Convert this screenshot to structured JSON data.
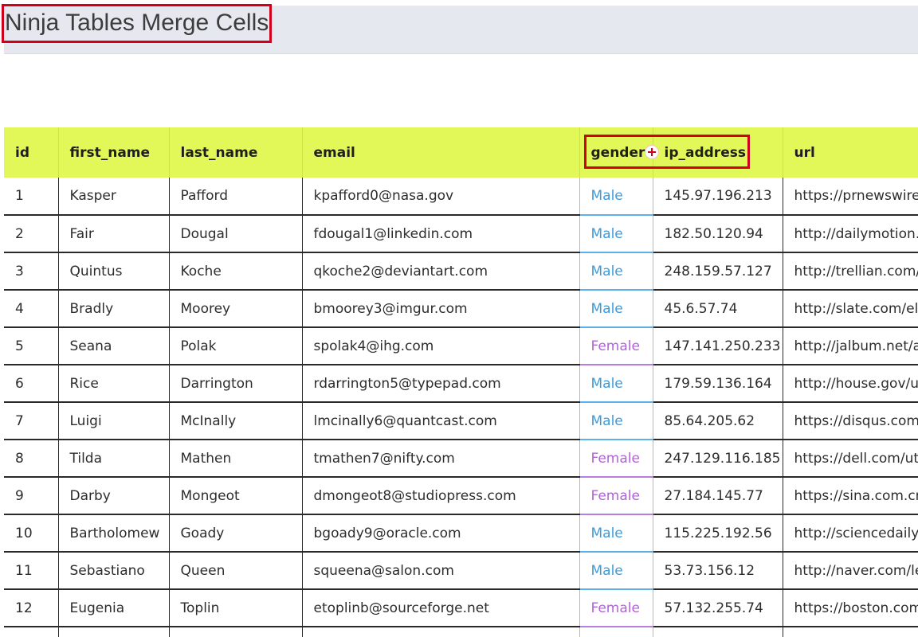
{
  "page": {
    "title": "Ninja Tables Merge Cells"
  },
  "table": {
    "columns": [
      "id",
      "first_name",
      "last_name",
      "email",
      "gender",
      "ip_address",
      "url"
    ],
    "rows": [
      [
        "1",
        "Kasper",
        "Pafford",
        "kpafford0@nasa.gov",
        "Male",
        "145.97.196.213",
        "https://prnewswire"
      ],
      [
        "2",
        "Fair",
        "Dougal",
        "fdougal1@linkedin.com",
        "Male",
        "182.50.120.94",
        "http://dailymotion."
      ],
      [
        "3",
        "Quintus",
        "Koche",
        "qkoche2@deviantart.com",
        "Male",
        "248.159.57.127",
        "http://trellian.com/"
      ],
      [
        "4",
        "Bradly",
        "Moorey",
        "bmoorey3@imgur.com",
        "Male",
        "45.6.57.74",
        "http://slate.com/el"
      ],
      [
        "5",
        "Seana",
        "Polak",
        "spolak4@ihg.com",
        "Female",
        "147.141.250.233",
        "http://jalbum.net/a"
      ],
      [
        "6",
        "Rice",
        "Darrington",
        "rdarrington5@typepad.com",
        "Male",
        "179.59.136.164",
        "http://house.gov/u"
      ],
      [
        "7",
        "Luigi",
        "McInally",
        "lmcinally6@quantcast.com",
        "Male",
        "85.64.205.62",
        "https://disqus.com"
      ],
      [
        "8",
        "Tilda",
        "Mathen",
        "tmathen7@nifty.com",
        "Female",
        "247.129.116.185",
        "https://dell.com/ut"
      ],
      [
        "9",
        "Darby",
        "Mongeot",
        "dmongeot8@studiopress.com",
        "Female",
        "27.184.145.77",
        "https://sina.com.cr"
      ],
      [
        "10",
        "Bartholomew",
        "Goady",
        "bgoady9@oracle.com",
        "Male",
        "115.225.192.56",
        "http://sciencedaily."
      ],
      [
        "11",
        "Sebastiano",
        "Queen",
        "squeena@salon.com",
        "Male",
        "53.73.156.12",
        "http://naver.com/le"
      ],
      [
        "12",
        "Eugenia",
        "Toplin",
        "etoplinb@sourceforge.net",
        "Female",
        "57.132.255.74",
        "https://boston.com"
      ],
      [
        "",
        "",
        "",
        "",
        "",
        "",
        ""
      ]
    ]
  },
  "colors": {
    "header_bg": "#e2f858",
    "highlight_box": "#d0021b",
    "male_text": "#3d9bdc",
    "female_text": "#b162d9"
  },
  "icons": {
    "merge_cursor": "plus-cursor-icon"
  }
}
